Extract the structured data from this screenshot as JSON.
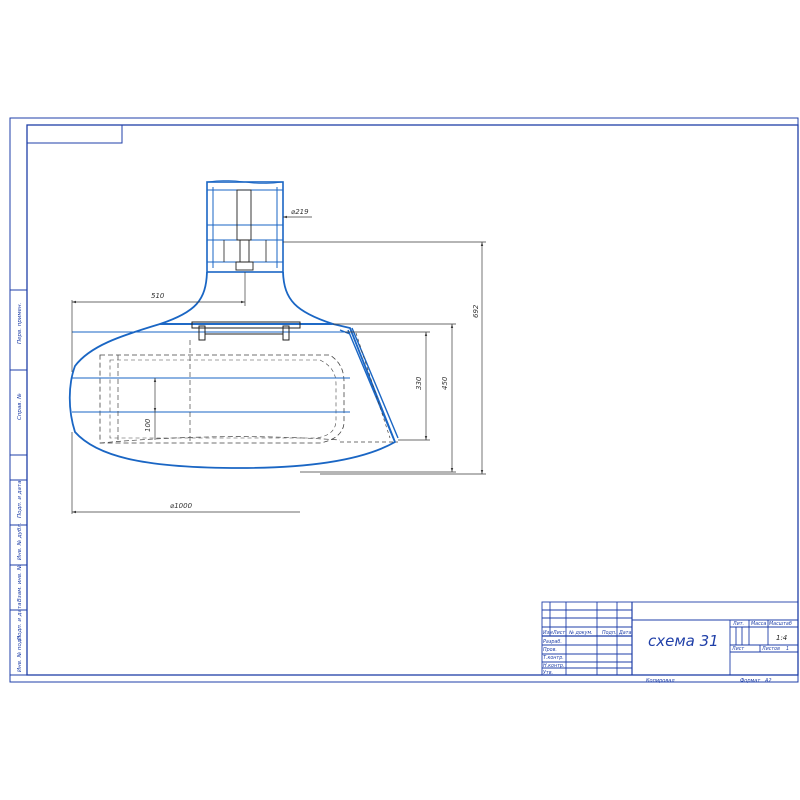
{
  "dimensions": {
    "d_pipe": "⌀219",
    "d_drum": "⌀1000",
    "half_width": "510",
    "total_height": "692",
    "h_450": "450",
    "h_330": "330",
    "h_100": "100"
  },
  "side_stamps": [
    "Перв. примен.",
    "Справ. №",
    "Подп. и дата",
    "Инв. № дубл.",
    "Взам. инв. №",
    "Подп. и дата",
    "Инв. № подл."
  ],
  "title_block": {
    "drawing_name": "схема 31",
    "scale": "1:4",
    "sheet_label": "Лист",
    "sheets_label": "Листов",
    "sheets_count": "1",
    "col_headers": [
      "Лит.",
      "Масса",
      "Масштаб"
    ],
    "row_headers": [
      "Изм.",
      "Лист",
      "№ докум.",
      "Подп.",
      "Дата"
    ],
    "role_labels": [
      "Разраб.",
      "Пров.",
      "Т.контр.",
      "Н.контр.",
      "Утв."
    ],
    "copied_label": "Копировал",
    "format_label": "Формат",
    "format_value": "А2"
  },
  "colors": {
    "frame": "#1f3fa8",
    "outline": "#1a66c4",
    "dims": "#3a3a3a",
    "hidden": "#444444"
  }
}
